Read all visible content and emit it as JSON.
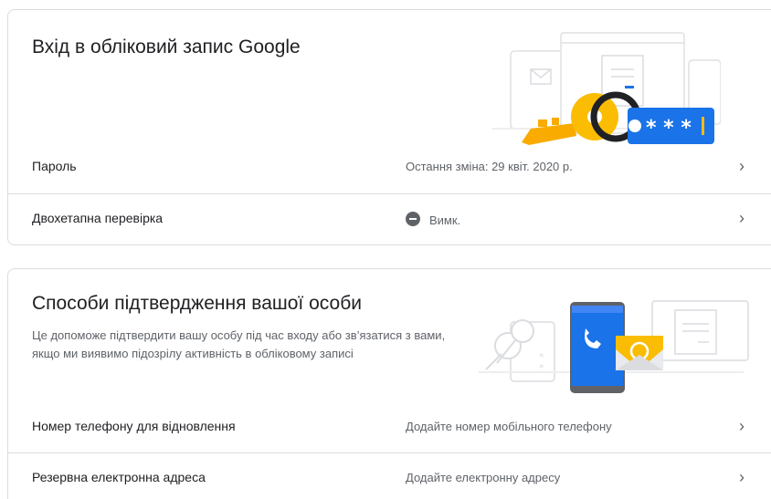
{
  "signin": {
    "title": "Вхід в обліковий запис Google",
    "rows": [
      {
        "label": "Пароль",
        "value": "Остання зміна: 29 квіт. 2020 р."
      },
      {
        "label": "Двохетапна перевірка",
        "value": "Вимк."
      }
    ]
  },
  "verify": {
    "title": "Способи підтвердження вашої особи",
    "description": "Це допоможе підтвердити вашу особу під час входу або зв’язатися з вами, якщо ми виявимо підозрілу активність в обліковому записі",
    "rows": [
      {
        "label": "Номер телефону для відновлення",
        "value": "Додайте номер мобільного телефону"
      },
      {
        "label": "Резервна електронна адреса",
        "value": "Додайте електронну адресу"
      }
    ]
  },
  "chevron_glyph": "›",
  "icons": {
    "off_status": "minus-circle-icon",
    "chevron": "chevron-right-icon"
  },
  "colors": {
    "google_blue": "#1a73e8",
    "google_yellow": "#fbbc04",
    "key_orange": "#f9ab00",
    "divider": "#dadce0",
    "secondary_text": "#5f6368"
  }
}
